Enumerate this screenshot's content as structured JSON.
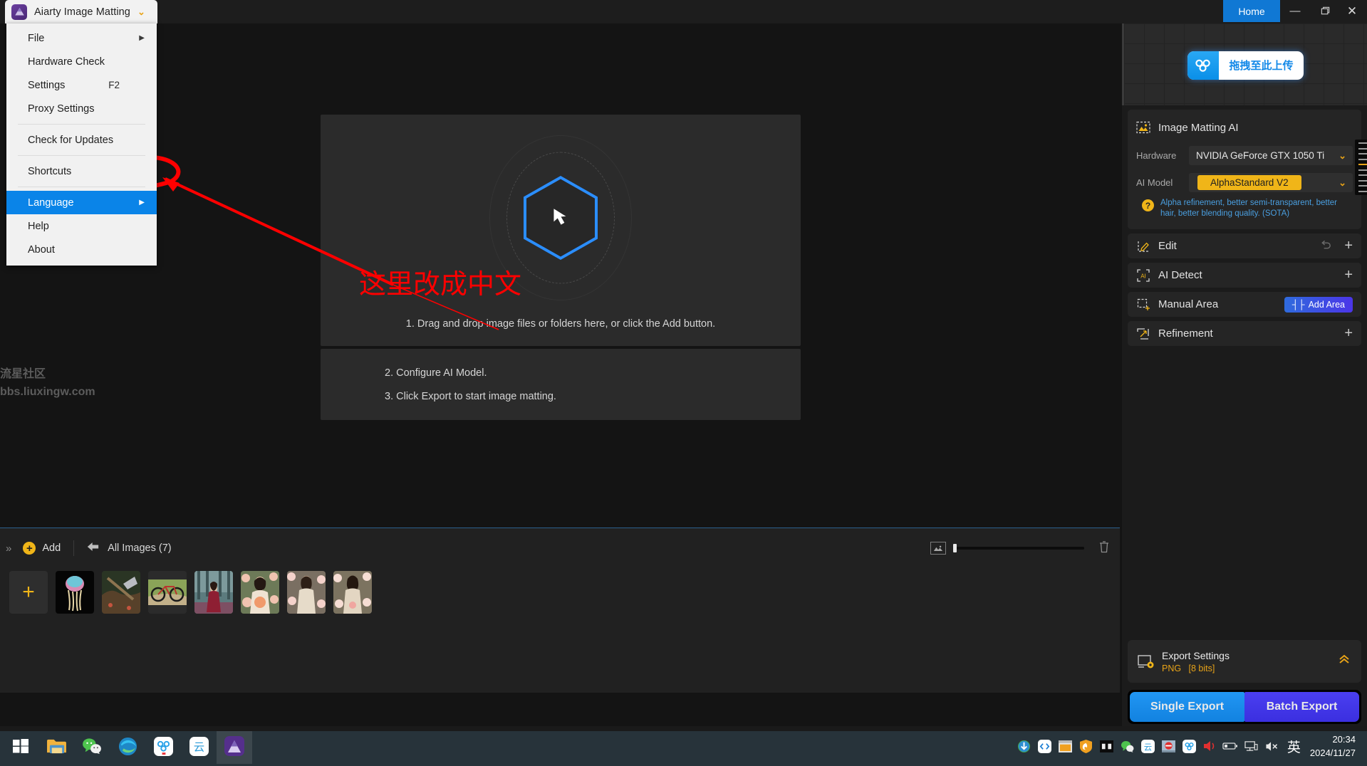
{
  "titlebar": {
    "app_name": "Aiarty Image Matting",
    "dropdown_caret": "⌄",
    "home_label": "Home",
    "minimize": "—",
    "maximize": "❐",
    "close": "✕"
  },
  "menu": {
    "items": [
      {
        "label": "File",
        "submenu": true,
        "accel": "",
        "selected": false
      },
      {
        "label": "Hardware Check",
        "submenu": false,
        "accel": "",
        "selected": false
      },
      {
        "label": "Settings",
        "submenu": false,
        "accel": "F2",
        "selected": false
      },
      {
        "label": "Proxy Settings",
        "submenu": false,
        "accel": "",
        "selected": false
      },
      {
        "label": "Check for Updates",
        "submenu": false,
        "accel": "",
        "selected": false
      },
      {
        "label": "Shortcuts",
        "submenu": false,
        "accel": "",
        "selected": false
      },
      {
        "label": "Language",
        "submenu": true,
        "accel": "",
        "selected": true
      },
      {
        "label": "Help",
        "submenu": false,
        "accel": "",
        "selected": false
      },
      {
        "label": "About",
        "submenu": false,
        "accel": "",
        "selected": false
      }
    ],
    "submenu_arrow": "▶"
  },
  "canvas": {
    "watermark_line1": "流星社区",
    "watermark_line2": "bbs.liuxingw.com",
    "annotation_text": "这里改成中文",
    "annotation_color": "#ff0000",
    "step1": "1. Drag and drop image files or folders here, or click the Add button.",
    "step2": "2. Configure AI Model.",
    "step3": "3. Click Export to start image matting."
  },
  "filmstrip": {
    "collapse_icon": "»",
    "add_label": "Add",
    "add_plus": "+",
    "back_arrow": "⬅",
    "all_images_label": "All Images (7)",
    "thumb_add_plus": "+",
    "thumbnails": [
      {
        "name": "jellyfish"
      },
      {
        "name": "axe-mossy-forest"
      },
      {
        "name": "mountain-bike"
      },
      {
        "name": "woman-red-dress-forest"
      },
      {
        "name": "woman-peach-bouquet"
      },
      {
        "name": "woman-white-dress-roses"
      },
      {
        "name": "woman-beige-dress-roses"
      }
    ]
  },
  "right_panel": {
    "upload_overlay": {
      "text": "拖拽至此上传"
    },
    "matting": {
      "title": "Image Matting AI",
      "hardware_label": "Hardware",
      "hardware_value": "NVIDIA GeForce GTX 1050 Ti",
      "model_label": "AI Model",
      "model_value": "AlphaStandard  V2",
      "model_desc": "Alpha refinement, better semi-transparent, better hair, better blending quality. (SOTA)",
      "chevron": "⌄",
      "question_mark": "?",
      "accent_yellow": "#f0b518",
      "desc_blue": "#4a9fe0"
    },
    "sections": [
      {
        "name": "edit",
        "label": "Edit",
        "has_undo": true,
        "action": "+"
      },
      {
        "name": "ai-detect",
        "label": "AI Detect",
        "has_undo": false,
        "action": "+"
      },
      {
        "name": "manual-area",
        "label": "Manual Area",
        "has_undo": false,
        "button_label": "Add Area",
        "button_icon": "┤├"
      },
      {
        "name": "refinement",
        "label": "Refinement",
        "has_undo": false,
        "action": "+"
      }
    ],
    "export": {
      "title": "Export Settings",
      "format": "PNG",
      "bits": "[8 bits]",
      "collapse_chev": "«",
      "single_label": "Single Export",
      "batch_label": "Batch Export"
    }
  },
  "taskbar": {
    "items": [
      {
        "name": "start-button"
      },
      {
        "name": "file-explorer"
      },
      {
        "name": "wechat"
      },
      {
        "name": "microsoft-edge"
      },
      {
        "name": "baidu-netdisk"
      },
      {
        "name": "wps-cloud"
      },
      {
        "name": "aiarty-image-matting",
        "active": true
      }
    ],
    "tray": [
      {
        "name": "internet-download-manager"
      },
      {
        "name": "code-editor"
      },
      {
        "name": "window-app"
      },
      {
        "name": "huorong-security"
      },
      {
        "name": "display-tool"
      },
      {
        "name": "wechat-tray"
      },
      {
        "name": "wps-cloud-tray"
      },
      {
        "name": "no-entry-tool"
      },
      {
        "name": "baidu-netdisk-tray"
      },
      {
        "name": "volume-speaker"
      },
      {
        "name": "battery"
      },
      {
        "name": "network"
      },
      {
        "name": "volume-muted"
      }
    ],
    "input_language": "英",
    "clock_time": "20:34",
    "clock_date": "2024/11/27"
  }
}
